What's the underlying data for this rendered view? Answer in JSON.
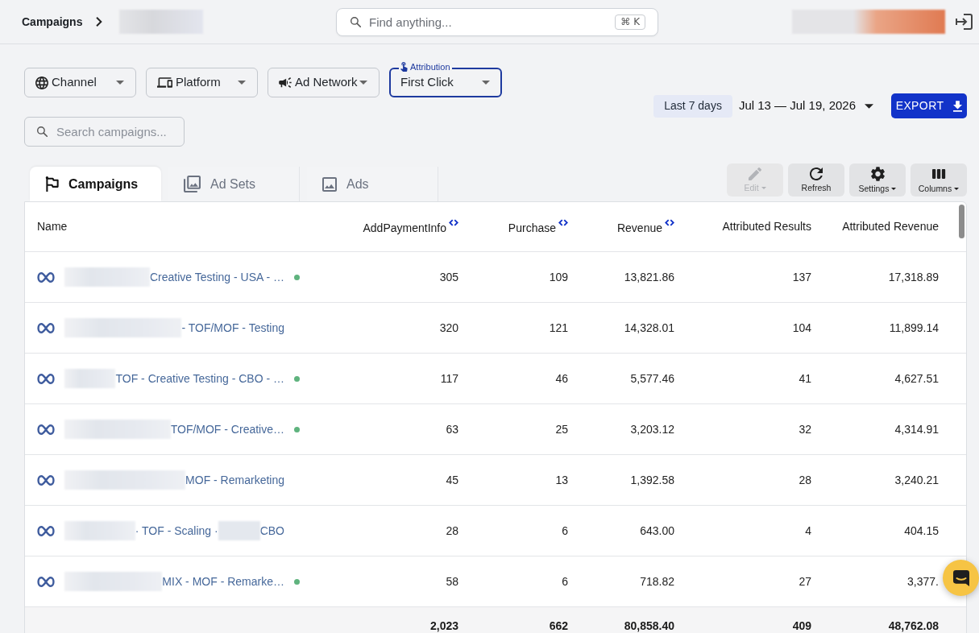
{
  "header": {
    "breadcrumb": "Campaigns",
    "search": {
      "placeholder": "Find anything...",
      "shortcut": "⌘ K"
    }
  },
  "filters": [
    {
      "kind": "dropdown",
      "label": "Channel"
    },
    {
      "kind": "dropdown",
      "label": "Platform"
    },
    {
      "kind": "dropdown",
      "label": "Ad Network"
    },
    {
      "kind": "outlined_select",
      "label": "Attribution",
      "value": "First Click"
    }
  ],
  "campaign_search": {
    "placeholder": "Search campaigns..."
  },
  "date_range": {
    "preset": "Last 7 days",
    "range": "Jul 13 — Jul 19, 2026"
  },
  "export_button": {
    "label": "EXPORT"
  },
  "tabs": [
    {
      "label": "Campaigns",
      "selected": true
    },
    {
      "label": "Ad Sets",
      "selected": false
    },
    {
      "label": "Ads",
      "selected": false
    }
  ],
  "toolbar": [
    {
      "label": "Edit",
      "disabled": true,
      "menu": true
    },
    {
      "label": "Refresh",
      "disabled": false,
      "menu": false
    },
    {
      "label": "Settings",
      "disabled": false,
      "menu": true
    },
    {
      "label": "Columns",
      "disabled": false,
      "menu": true
    }
  ],
  "table": {
    "columns": [
      {
        "label": "Name",
        "sortable": false
      },
      {
        "label": "AddPaymentInfo",
        "sortable": true
      },
      {
        "label": "Purchase",
        "sortable": true
      },
      {
        "label": "Revenue",
        "sortable": true
      },
      {
        "label": "Attributed Results",
        "sortable": false
      },
      {
        "label": "Attributed Revenue",
        "sortable": false
      }
    ],
    "rows": [
      {
        "active": true,
        "cells": [
          "Creative Testing - USA - …",
          "305",
          "109",
          "13,821.86",
          "137",
          "17,318.89"
        ]
      },
      {
        "active": false,
        "cells": [
          "- TOF/MOF - Testing",
          "320",
          "121",
          "14,328.01",
          "104",
          "11,899.14"
        ]
      },
      {
        "active": true,
        "cells": [
          "TOF - Creative Testing - CBO - …",
          "117",
          "46",
          "5,577.46",
          "41",
          "4,627.51"
        ]
      },
      {
        "active": true,
        "cells": [
          "TOF/MOF - Creative…",
          "63",
          "25",
          "3,203.12",
          "32",
          "4,314.91"
        ]
      },
      {
        "active": false,
        "cells": [
          "MOF - Remarketing",
          "45",
          "13",
          "1,392.58",
          "28",
          "3,240.21"
        ]
      },
      {
        "active": false,
        "cells": [
          [
            "· TOF - Scaling ·",
            "CBO"
          ],
          "28",
          "6",
          "643.00",
          "4",
          "404.15"
        ]
      },
      {
        "active": true,
        "cells": [
          "MIX - MOF - Remarke…",
          "58",
          "6",
          "718.82",
          "27",
          "3,377."
        ]
      }
    ],
    "totals": [
      "2,023",
      "662",
      "80,858.40",
      "409",
      "48,762.08"
    ]
  }
}
